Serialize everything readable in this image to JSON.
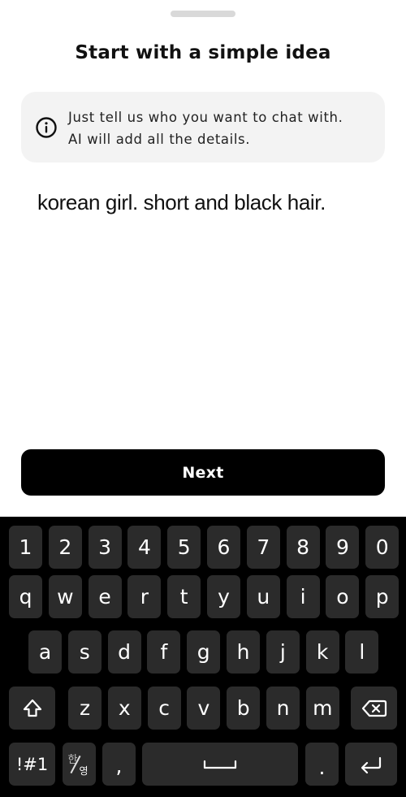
{
  "sheet": {
    "title": "Start with a simple idea",
    "info_line1": "Just tell us who you want to chat with.",
    "info_line2": "AI will add all the details.",
    "input_value": "korean girl. short and black hair.",
    "next_label": "Next"
  },
  "keyboard": {
    "numbers": [
      "1",
      "2",
      "3",
      "4",
      "5",
      "6",
      "7",
      "8",
      "9",
      "0"
    ],
    "row1": [
      "q",
      "w",
      "e",
      "r",
      "t",
      "y",
      "u",
      "i",
      "o",
      "p"
    ],
    "row2": [
      "a",
      "s",
      "d",
      "f",
      "g",
      "h",
      "j",
      "k",
      "l"
    ],
    "row3": [
      "z",
      "x",
      "c",
      "v",
      "b",
      "n",
      "m"
    ],
    "symbols_label": "!#1",
    "lang_top": "한",
    "lang_bottom": "영",
    "comma": ",",
    "period": "."
  },
  "colors": {
    "accent": "#000000",
    "info_background": "#f3f3f3",
    "key_background": "#2b2b2b",
    "keyboard_background": "#000000"
  }
}
